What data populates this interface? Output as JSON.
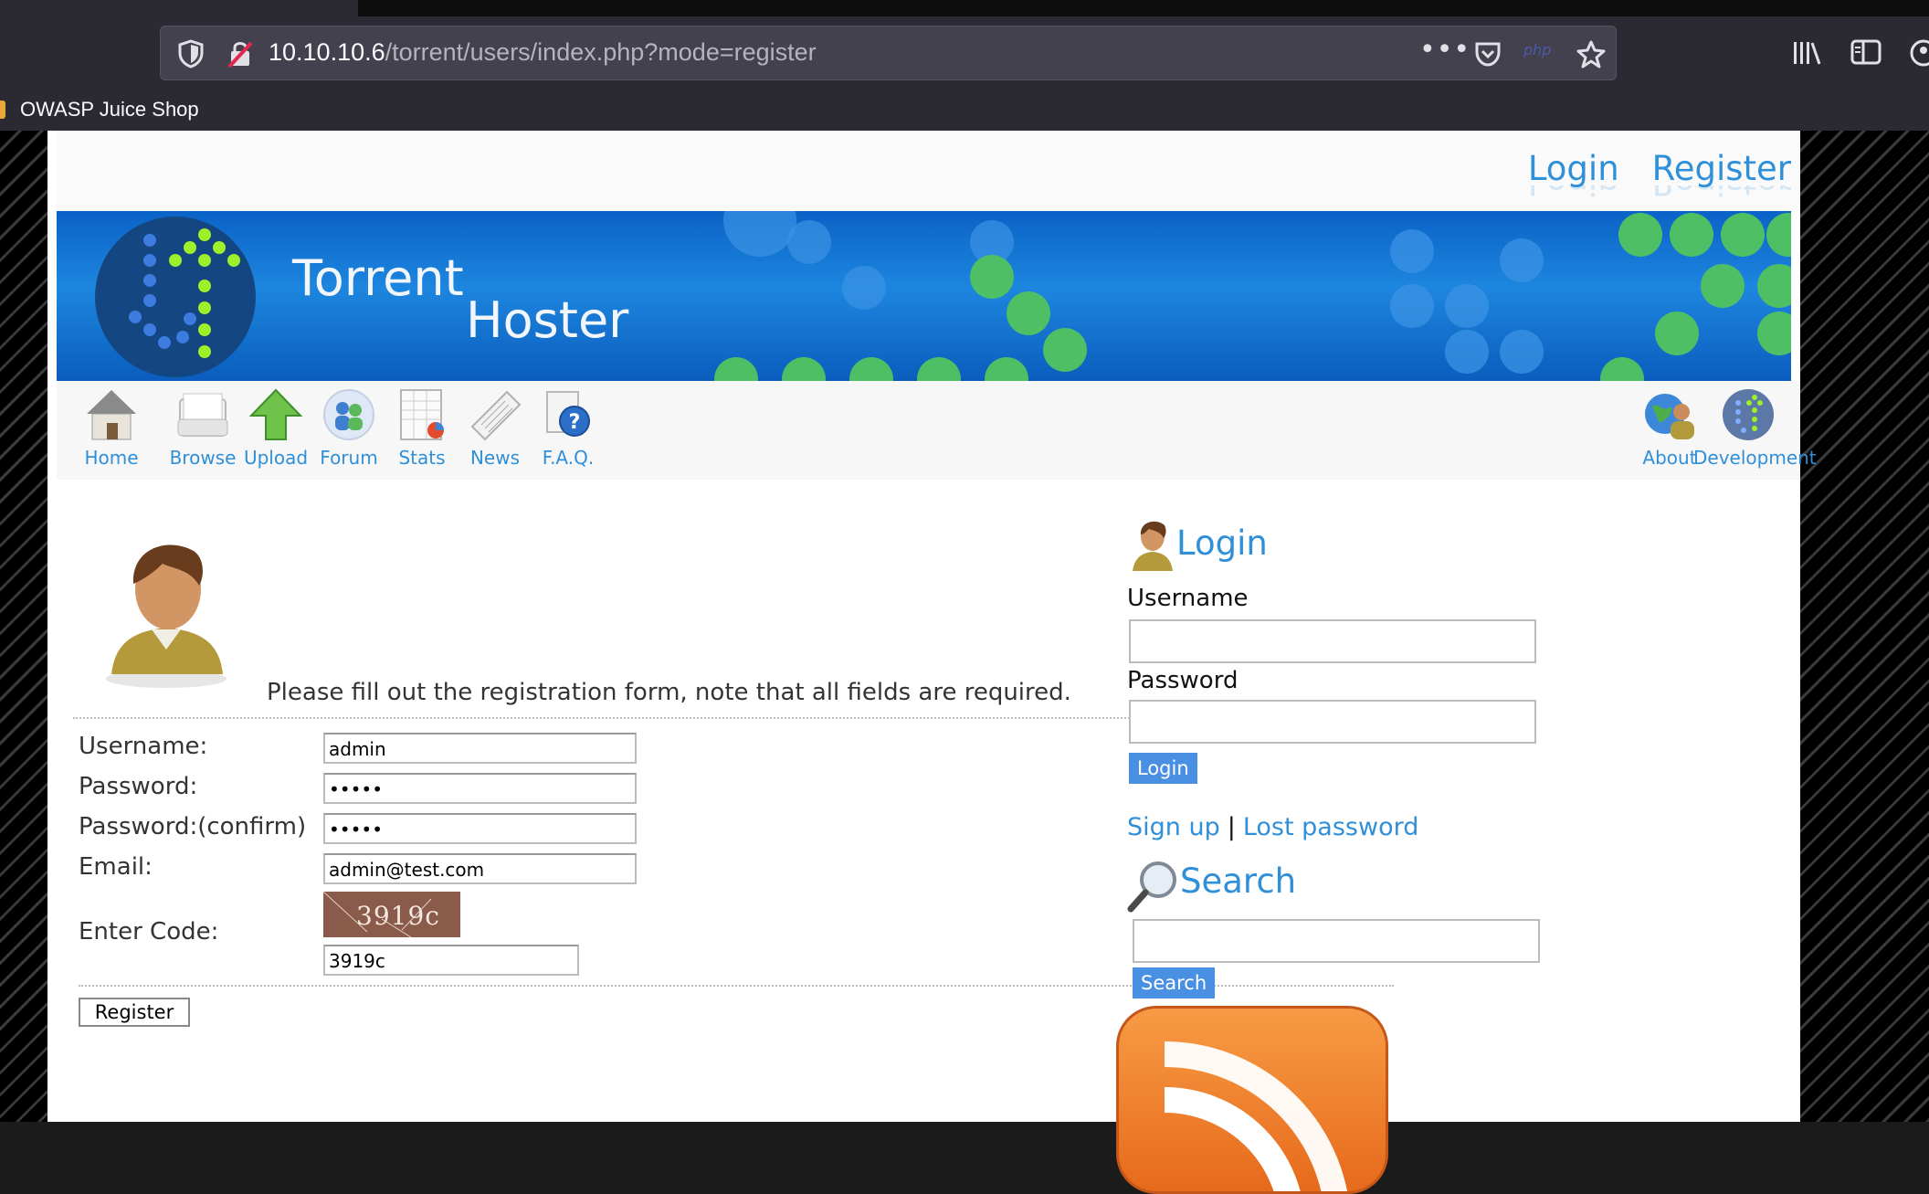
{
  "browser": {
    "url_host": "10.10.10.6",
    "url_path": "/torrent/users/index.php?mode=register",
    "bookmark": "OWASP Juice Shop",
    "icons": [
      "shield-icon",
      "insecure-lock-icon",
      "more-icon",
      "pocket-icon",
      "php-icon",
      "star-icon",
      "library-icon",
      "sidebar-icon",
      "account-icon"
    ],
    "php_badge": "php"
  },
  "site": {
    "top_links": [
      "Login",
      "Register"
    ],
    "title_line1": "Torrent",
    "title_line2": "Hoster",
    "nav": [
      "Home",
      "Browse",
      "Upload",
      "Forum",
      "Stats",
      "News",
      "F.A.Q."
    ],
    "nav_right": [
      "About",
      "Development"
    ]
  },
  "register": {
    "intro": "Please fill out the registration form, note that all fields are required.",
    "labels": {
      "username": "Username:",
      "password": "Password:",
      "password_confirm": "Password:(confirm)",
      "email": "Email:",
      "code": "Enter Code:"
    },
    "values": {
      "username": "admin",
      "password": "•••••",
      "password_confirm": "•••••",
      "email": "admin@test.com",
      "captcha_image_text": "3919c",
      "code": "3919c"
    },
    "submit": "Register"
  },
  "sidebar": {
    "login_title": "Login",
    "username_label": "Username",
    "password_label": "Password",
    "login_button": "Login",
    "signup": "Sign up",
    "separator": "|",
    "lost_password": "Lost password",
    "search_title": "Search",
    "search_button": "Search"
  },
  "colors": {
    "link_blue": "#2f8fd8",
    "banner_blue": "#1d86df",
    "button_blue": "#4a90e2",
    "rss_orange": "#f08030"
  }
}
